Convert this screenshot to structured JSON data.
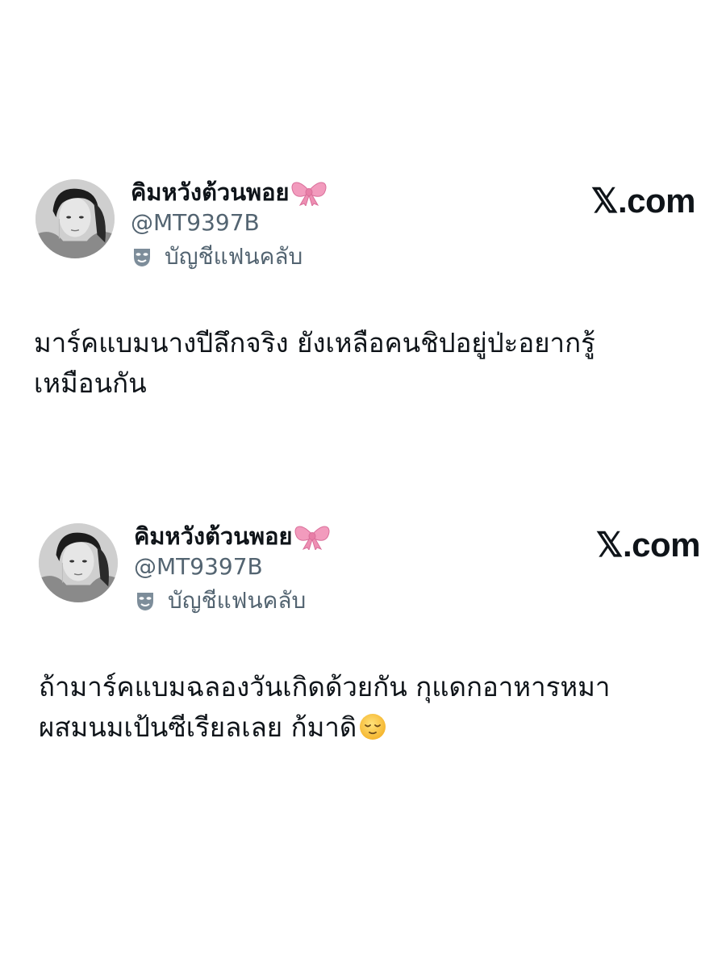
{
  "tweets": [
    {
      "display_name": "คิมหวังต้วนพอย",
      "name_emoji": "ribbon-bow",
      "handle": "@MT9397B",
      "account_label": "บัญชีแฟนคลับ",
      "account_icon": "theater-mask-icon",
      "brand": "𝕏.com",
      "text_lines": [
        "มาร์คแบมนางปีลึกจริง ยังเหลือคนชิปอยู่ป่ะอยากรู้",
        "เหมือนกัน"
      ]
    },
    {
      "display_name": "คิมหวังต้วนพอย",
      "name_emoji": "ribbon-bow",
      "handle": "@MT9397B",
      "account_label": "บัญชีแฟนคลับ",
      "account_icon": "theater-mask-icon",
      "brand": "𝕏.com",
      "text_lines": [
        "ถ้ามาร์คแบมฉลองวันเกิดด้วยกัน กุแดกอาหารหมา",
        "ผสมนมเป้นซีเรียลเลย ก้มาดิ"
      ],
      "trailing_emoji": "relieved-face"
    }
  ],
  "colors": {
    "text_primary": "#0f1419",
    "text_secondary": "#536471",
    "bow_pink": "#f29bbd"
  }
}
